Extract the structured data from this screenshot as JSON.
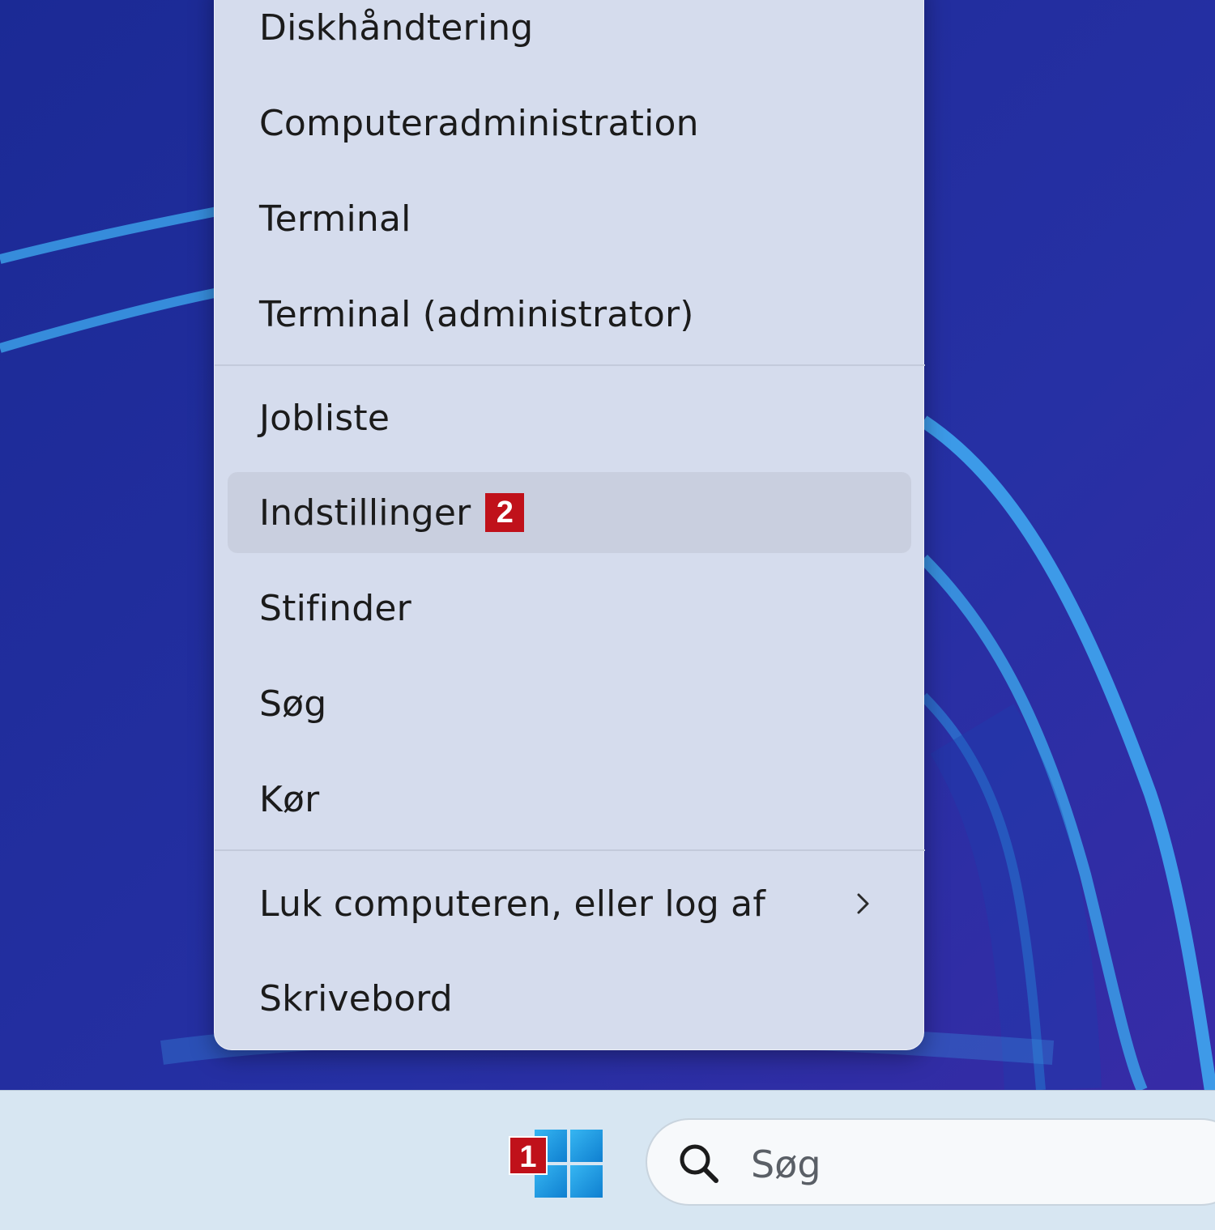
{
  "context_menu": {
    "items": [
      {
        "label": "Diskhåndtering"
      },
      {
        "label": "Computeradministration"
      },
      {
        "label": "Terminal"
      },
      {
        "label": "Terminal (administrator)"
      },
      {
        "label": "Jobliste"
      },
      {
        "label": "Indstillinger",
        "badge": "2",
        "hovered": true
      },
      {
        "label": "Stifinder"
      },
      {
        "label": "Søg"
      },
      {
        "label": "Kør"
      },
      {
        "label": "Luk computeren, eller log af",
        "has_submenu": true
      },
      {
        "label": "Skrivebord"
      }
    ]
  },
  "taskbar": {
    "start_badge": "1",
    "search_placeholder": "Søg"
  },
  "icons": {
    "start": "windows-logo-icon",
    "search": "search-icon",
    "submenu": "chevron-right-icon"
  },
  "colors": {
    "badge": "#c0111a",
    "menu_bg": "#d5dced",
    "taskbar_bg": "#d7e6f2",
    "start_icon": "#1a9ce0"
  }
}
